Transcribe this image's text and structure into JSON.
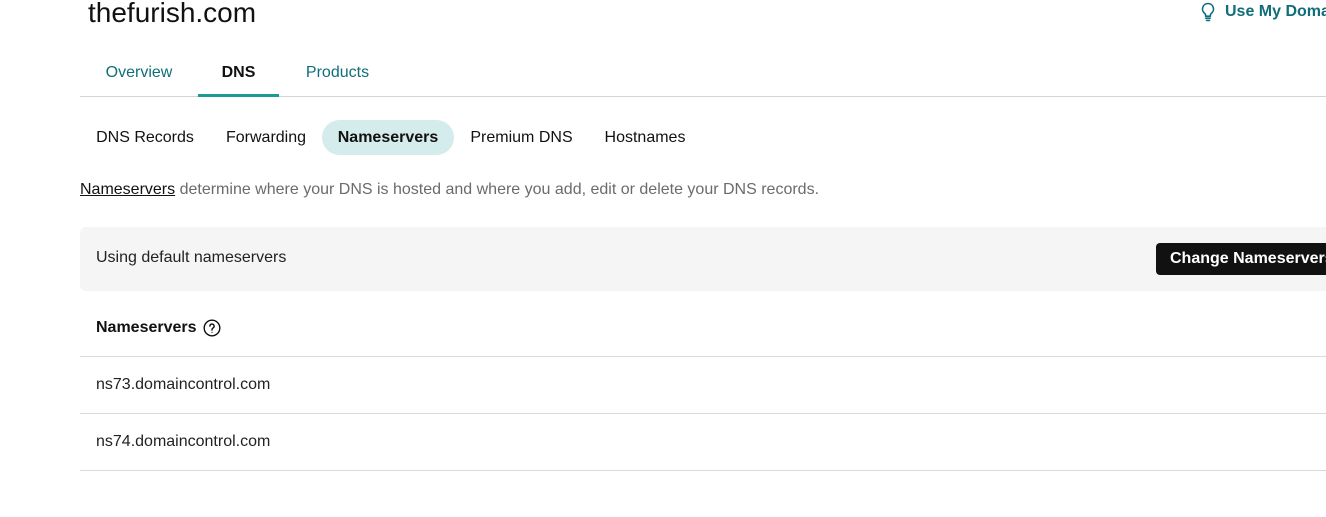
{
  "domain": "thefurish.com",
  "header_action": {
    "label": "Use My Domain",
    "icon": "lightbulb-icon"
  },
  "tabs": [
    {
      "label": "Overview",
      "active": false
    },
    {
      "label": "DNS",
      "active": true
    },
    {
      "label": "Products",
      "active": false
    }
  ],
  "subtabs": [
    {
      "label": "DNS Records",
      "active": false
    },
    {
      "label": "Forwarding",
      "active": false
    },
    {
      "label": "Nameservers",
      "active": true
    },
    {
      "label": "Premium DNS",
      "active": false
    },
    {
      "label": "Hostnames",
      "active": false
    }
  ],
  "description": {
    "link": "Nameservers",
    "text": " determine where your DNS is hosted and where you add, edit or delete your DNS records."
  },
  "banner": {
    "text": "Using default nameservers",
    "button_label": "Change Nameservers"
  },
  "nameservers": {
    "header": "Nameservers",
    "help_icon": "question-circle-icon",
    "rows": [
      "ns73.domaincontrol.com",
      "ns74.domaincontrol.com"
    ]
  },
  "colors": {
    "accent": "#0f6e7a",
    "active_underline": "#1a9a92",
    "active_pill": "#d4ecec",
    "banner_bg": "#f5f5f6",
    "button_bg": "#111111"
  }
}
